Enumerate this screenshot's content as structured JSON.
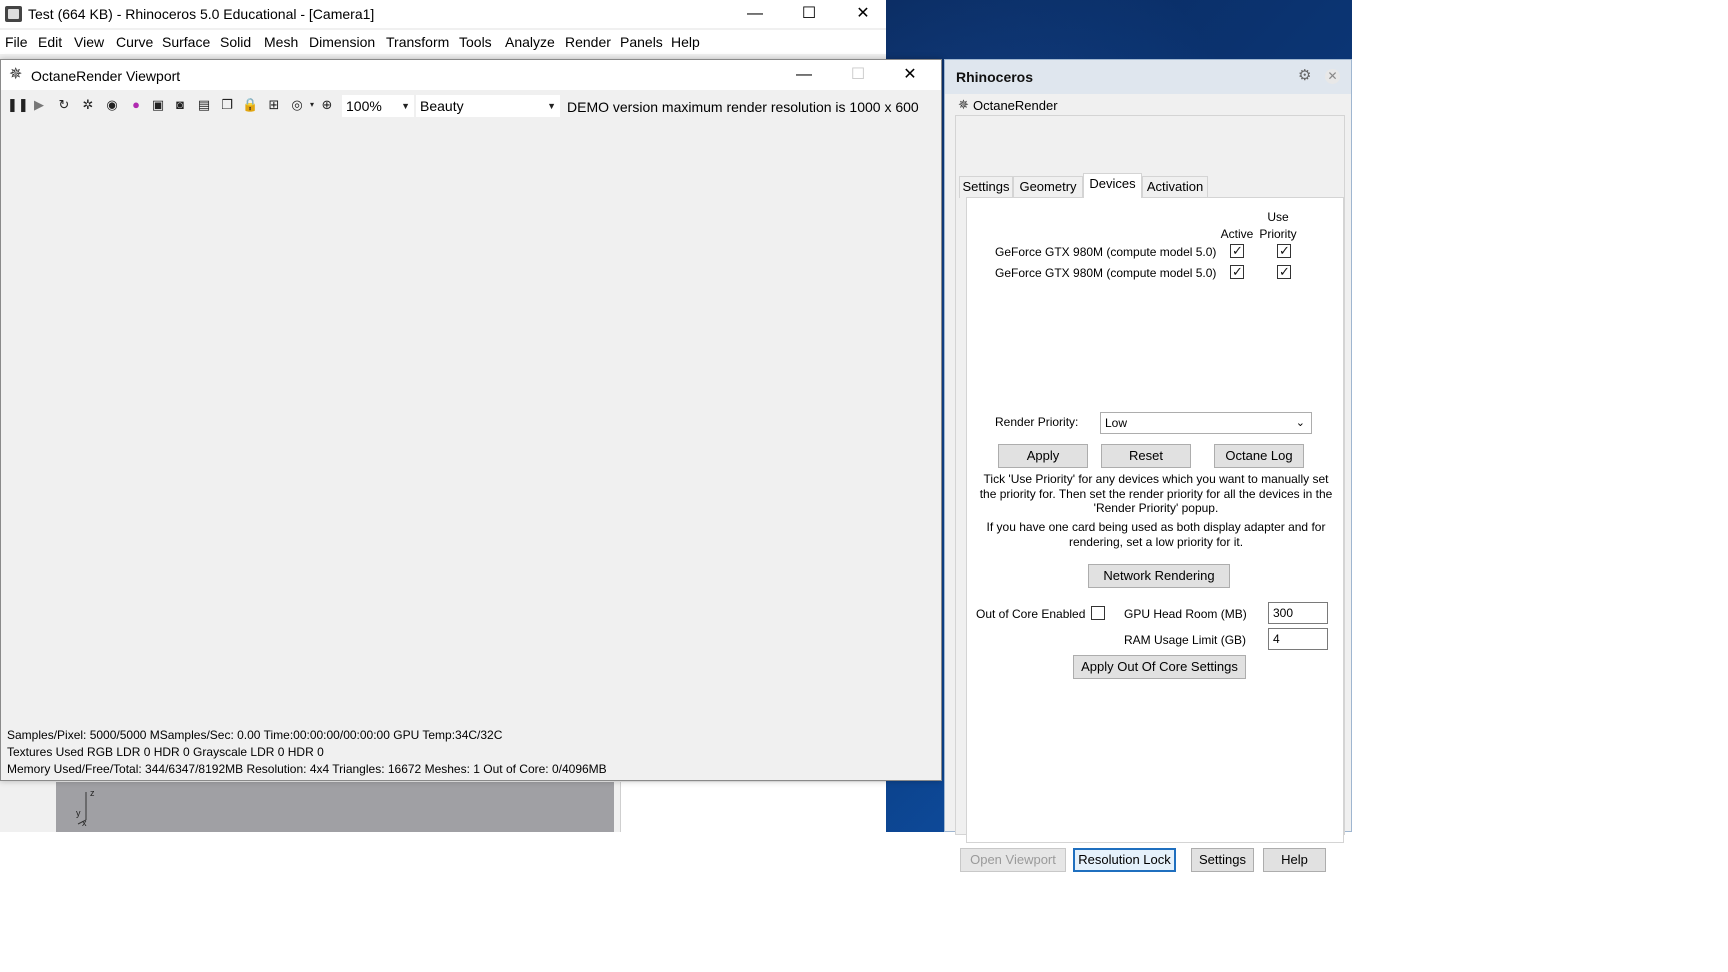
{
  "rhino": {
    "title": "Test (664 KB) - Rhinoceros 5.0 Educational - [Camera1]",
    "menu": [
      "File",
      "Edit",
      "View",
      "Curve",
      "Surface",
      "Solid",
      "Mesh",
      "Dimension",
      "Transform",
      "Tools",
      "Analyze",
      "Render",
      "Panels",
      "Help"
    ],
    "axis_z": "z",
    "axis_y": "y",
    "axis_x": "x"
  },
  "octane_viewport": {
    "title": "OctaneRender Viewport",
    "zoom": "100%",
    "pass": "Beauty",
    "demo_note": "DEMO version maximum render resolution is 1000 x 600",
    "status_line1": "Samples/Pixel: 5000/5000  MSamples/Sec: 0.00  Time:00:00:00/00:00:00  GPU Temp:34C/32C",
    "status_line2": "Textures Used RGB LDR 0  HDR 0  Grayscale LDR 0  HDR 0",
    "status_line3": "Memory Used/Free/Total: 344/6347/8192MB  Resolution: 4x4  Triangles: 16672  Meshes: 1 Out of Core: 0/4096MB"
  },
  "panel": {
    "title": "Rhinoceros",
    "plugin_tab": "OctaneRender",
    "tabs": [
      "Settings",
      "Geometry",
      "Devices",
      "Activation"
    ],
    "active_tab": "Devices",
    "col_active": "Active",
    "col_use": "Use",
    "col_priority": "Priority",
    "devices": [
      {
        "name": "GeForce GTX 980M (compute model 5.0)",
        "active": true,
        "use_priority": true
      },
      {
        "name": "GeForce GTX 980M (compute model 5.0)",
        "active": true,
        "use_priority": true
      }
    ],
    "render_priority_label": "Render Priority:",
    "render_priority_value": "Low",
    "apply": "Apply",
    "reset": "Reset",
    "octane_log": "Octane Log",
    "help1_line1": "Tick 'Use Priority' for any devices which you want to manually set",
    "help1_line2": "the priority for.  Then set the render priority for all the devices in the",
    "help1_line3": "'Render Priority' popup.",
    "help2_line1": "If you have one card being used as both display adapter and for",
    "help2_line2": "rendering, set a low priority for it.",
    "network_rendering": "Network Rendering",
    "out_of_core_label": "Out of Core Enabled",
    "out_of_core_enabled": false,
    "gpu_headroom_label": "GPU Head Room (MB)",
    "gpu_headroom_value": "300",
    "ram_limit_label": "RAM Usage Limit (GB)",
    "ram_limit_value": "4",
    "apply_ooc": "Apply Out Of Core Settings",
    "open_viewport": "Open Viewport",
    "resolution_lock": "Resolution Lock",
    "settings": "Settings",
    "help": "Help"
  }
}
